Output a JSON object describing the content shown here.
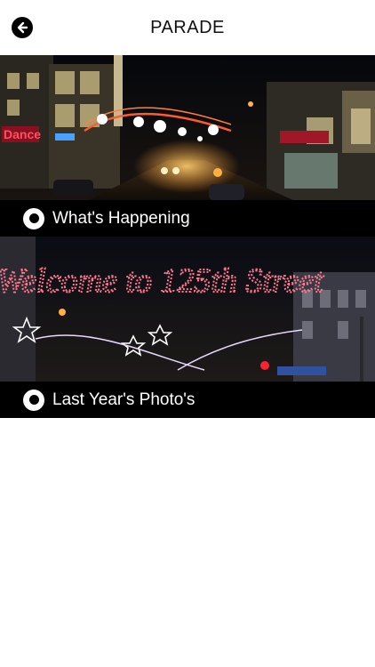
{
  "header": {
    "title": "PARADE",
    "back_icon": "arrow-left-circle-icon"
  },
  "cards": [
    {
      "label": "What's Happening",
      "image": "night-street-holiday-lights-photo",
      "shop_sign": "Dance"
    },
    {
      "label": "Last Year's Photo's",
      "image": "welcome-to-125th-street-lights-photo",
      "light_sign": "Welcome to 125th Street"
    }
  ],
  "colors": {
    "background": "#ffffff",
    "caption_bar": "#000000",
    "caption_text": "#ffffff"
  }
}
